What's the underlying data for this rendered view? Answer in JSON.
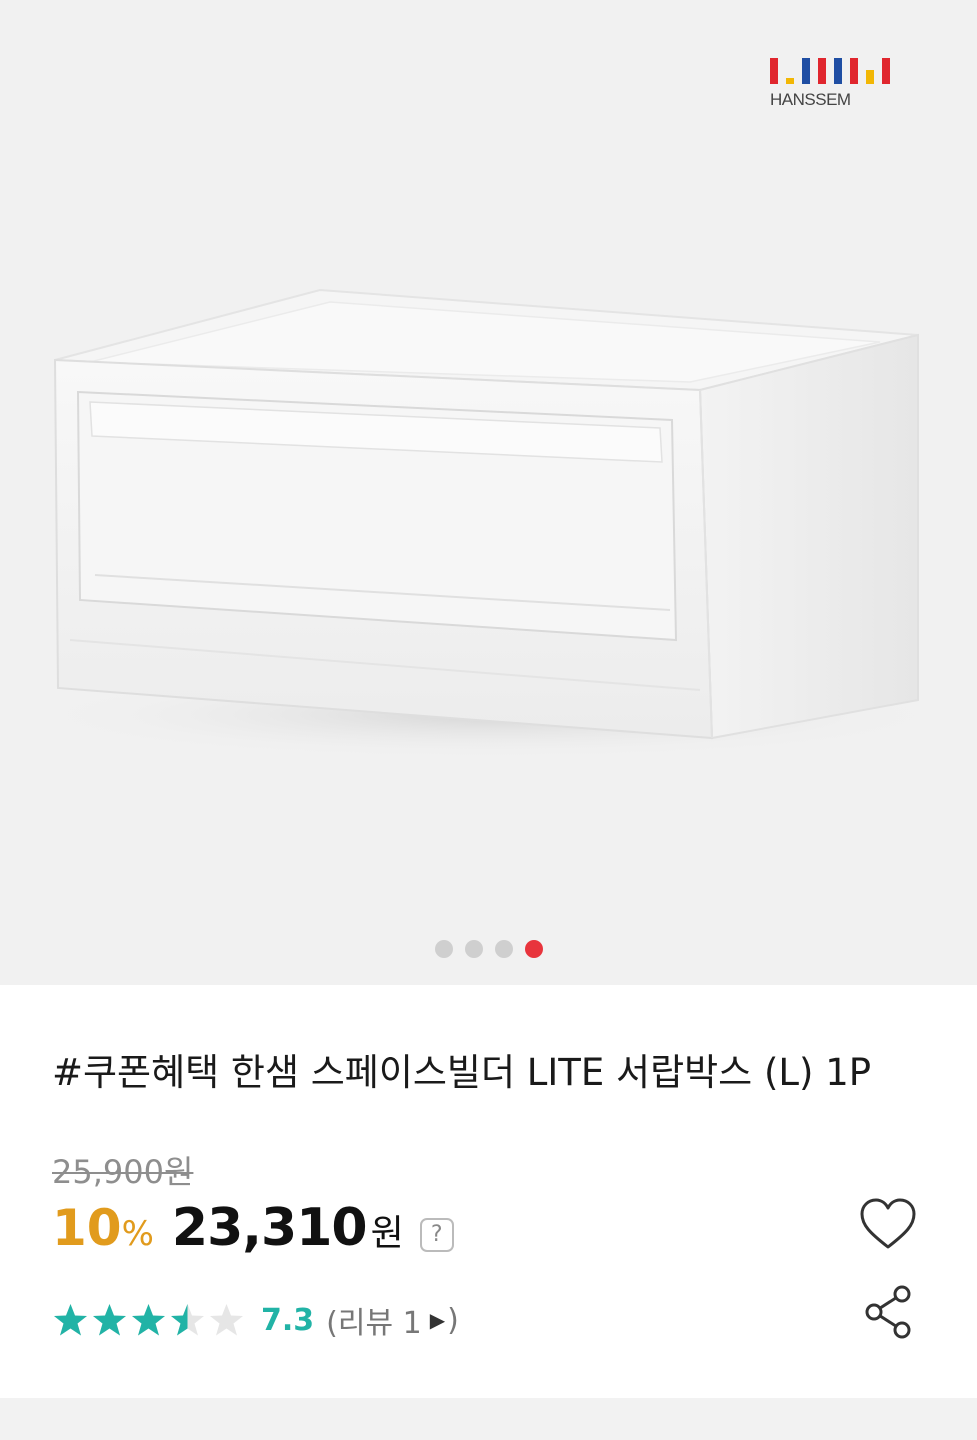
{
  "gallery": {
    "brand_name": "HANSSEM",
    "brand_colors": [
      "#e0262e",
      "#f2b705",
      "#1f4ea3",
      "#e0262e",
      "#1f4ea3",
      "#e0262e",
      "#f2b705",
      "#e0262e"
    ],
    "slide_count": 4,
    "active_slide": 4,
    "dot_inactive_color": "#cfcfcf",
    "dot_active_color": "#e8343c"
  },
  "product": {
    "title": "#쿠폰혜택 한샘 스페이스빌더 LITE 서랍박스 (L) 1P",
    "original_price": "25,900원",
    "discount_number": "10",
    "discount_unit": "%",
    "sale_price": "23,310",
    "currency": "원",
    "help_icon_label": "?"
  },
  "rating": {
    "score": "7.3",
    "stars_value": 3.5,
    "stars_max": 5,
    "star_color": "#21b3a6",
    "review_open": "(리뷰 1",
    "review_arrow": "▶",
    "review_close": ")"
  },
  "actions": {
    "wishlist_icon": "heart-icon",
    "share_icon": "share-icon"
  }
}
